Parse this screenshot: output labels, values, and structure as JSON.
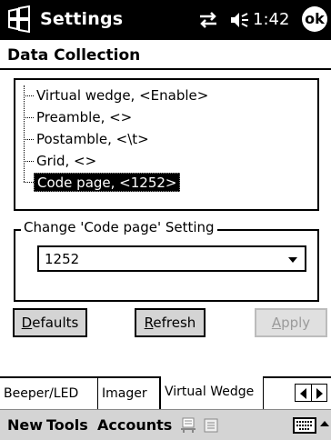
{
  "titlebar": {
    "title": "Settings",
    "clock": "1:42",
    "ok_label": "ok",
    "icons": [
      "windows-start-icon",
      "connectivity-icon",
      "volume-icon"
    ]
  },
  "page": {
    "title": "Data Collection"
  },
  "tree": {
    "items": [
      {
        "label": "Virtual wedge, <Enable>",
        "selected": false
      },
      {
        "label": "Preamble, <>",
        "selected": false
      },
      {
        "label": "Postamble, <\\t>",
        "selected": false
      },
      {
        "label": "Grid, <>",
        "selected": false
      },
      {
        "label": "Code page, <1252>",
        "selected": true
      }
    ]
  },
  "setting_group": {
    "legend": "Change 'Code page' Setting",
    "combo_value": "1252"
  },
  "buttons": {
    "defaults_first": "D",
    "defaults_rest": "efaults",
    "refresh_first": "R",
    "refresh_rest": "efresh",
    "apply_first": "A",
    "apply_rest": "pply"
  },
  "tabs": [
    {
      "label": "Beeper/LED"
    },
    {
      "label": "Imager"
    },
    {
      "label": "Virtual Wedge",
      "active": true
    }
  ],
  "menubar": {
    "new": "New",
    "tools": "Tools",
    "accounts": "Accounts"
  }
}
